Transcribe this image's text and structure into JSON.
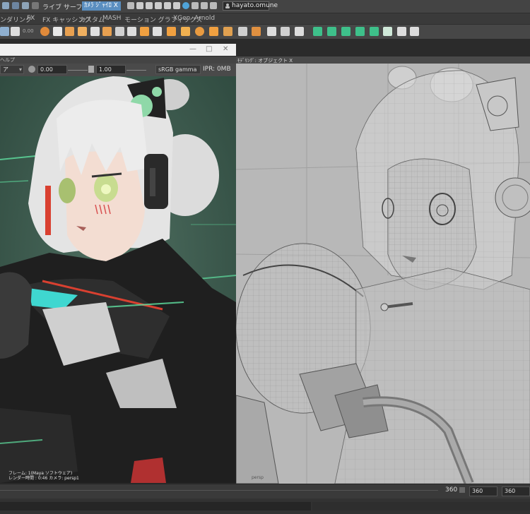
{
  "status_row": {
    "live_label": "ライブ サーフェスなし",
    "camera_field": "ｶﾒﾗ ｼﾞｬｲﾛ X",
    "user_field": "hayato.omune"
  },
  "shelf_tabs": [
    "ンダリング",
    "FX",
    "FX キャッシング",
    "カスタム",
    "MASH",
    "モーション グラフィックス",
    "XGen",
    "Arnold"
  ],
  "shelf": {
    "value_label": "0.00"
  },
  "render_view": {
    "menu_label": "ヘルプ",
    "toolbar": {
      "display_mode": "ア",
      "exposure": "0.00",
      "gamma": "1.00",
      "color_space": "sRGB gamma",
      "ipr_memory": "IPR: 0MB"
    },
    "info_lines": [
      "フレーム: 1(Maya ソフトウェア)",
      "レンダー時間 : 0:46 カメラ: persp1"
    ]
  },
  "viewport": {
    "header_label": "ﾓﾃﾞﾘﾝｸﾞ: オブジェクト X",
    "camera_label": "persp"
  },
  "timebar": {
    "end_frame": "360",
    "playback_end": "360",
    "anim_end": "360"
  },
  "colors": {
    "accent": "#5a8ec0",
    "render_bg": "#3d5a4d",
    "glow": "#5fe0a0"
  }
}
